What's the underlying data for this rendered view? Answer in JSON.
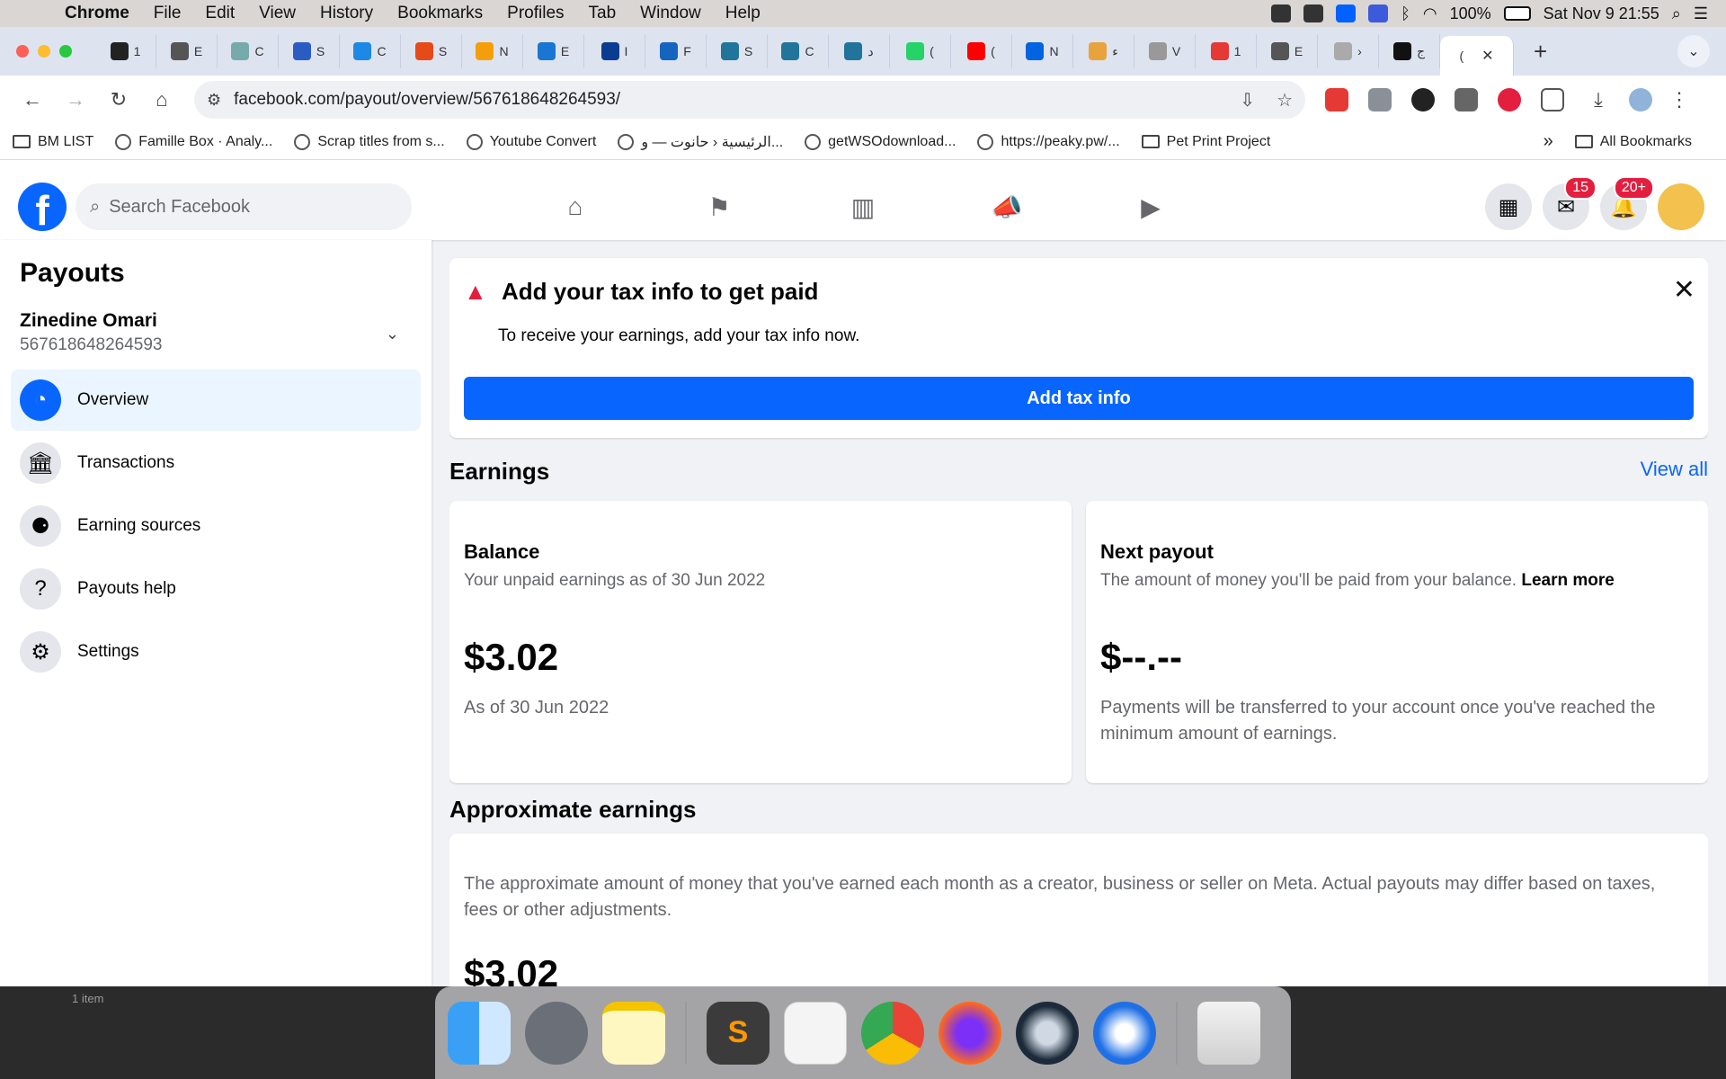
{
  "menubar": {
    "items": [
      "Chrome",
      "File",
      "Edit",
      "View",
      "History",
      "Bookmarks",
      "Profiles",
      "Tab",
      "Window",
      "Help"
    ],
    "battery": "100%",
    "datetime": "Sat Nov 9  21:55"
  },
  "tabs": [
    {
      "letter": "1",
      "color": "#222"
    },
    {
      "letter": "E",
      "color": "#555"
    },
    {
      "letter": "C",
      "color": "#7aa"
    },
    {
      "letter": "S",
      "color": "#2b5cc4"
    },
    {
      "letter": "C",
      "color": "#1e88e5"
    },
    {
      "letter": "S",
      "color": "#e64a19"
    },
    {
      "letter": "N",
      "color": "#f59e0b"
    },
    {
      "letter": "E",
      "color": "#1976d2"
    },
    {
      "letter": "I",
      "color": "#0a3d91"
    },
    {
      "letter": "F",
      "color": "#1565c0"
    },
    {
      "letter": "S",
      "color": "#21759b"
    },
    {
      "letter": "C",
      "color": "#21759b"
    },
    {
      "letter": "د",
      "color": "#21759b"
    },
    {
      "letter": "(",
      "color": "#25d366"
    },
    {
      "letter": "(",
      "color": "#ff0000"
    },
    {
      "letter": "N",
      "color": "#0064e0"
    },
    {
      "letter": "ء",
      "color": "#e8a33d"
    },
    {
      "letter": "V",
      "color": "#999"
    },
    {
      "letter": "1",
      "color": "#e53935"
    },
    {
      "letter": "E",
      "color": "#555"
    },
    {
      "letter": "›",
      "color": "#aaa"
    },
    {
      "letter": "ج",
      "color": "#111"
    }
  ],
  "active_tab": {
    "letter": "(",
    "close": "✕"
  },
  "address_bar": {
    "url": "facebook.com/payout/overview/567618648264593/"
  },
  "bookmarks": [
    {
      "label": "BM LIST",
      "type": "folder"
    },
    {
      "label": "Famille Box · Analy...",
      "type": "site"
    },
    {
      "label": "Scrap titles from s...",
      "type": "site"
    },
    {
      "label": "Youtube Convert",
      "type": "site"
    },
    {
      "label": "الرئيسية ‹ حانوت — و...",
      "type": "site"
    },
    {
      "label": "getWSOdownload...",
      "type": "site"
    },
    {
      "label": "https://peaky.pw/...",
      "type": "site"
    },
    {
      "label": "Pet Print Project",
      "type": "folder"
    }
  ],
  "bookmarks_more": "»",
  "all_bookmarks": "All Bookmarks",
  "facebook": {
    "logo": "f",
    "search_placeholder": "Search Facebook",
    "messenger_badge": "15",
    "notifications_badge": "20+"
  },
  "sidebar": {
    "title": "Payouts",
    "account_name": "Zinedine Omari",
    "account_id": "567618648264593",
    "items": [
      {
        "label": "Overview",
        "active": true
      },
      {
        "label": "Transactions",
        "active": false
      },
      {
        "label": "Earning sources",
        "active": false
      },
      {
        "label": "Payouts help",
        "active": false
      },
      {
        "label": "Settings",
        "active": false
      }
    ]
  },
  "tax_banner": {
    "title": "Add your tax info to get paid",
    "body": "To receive your earnings, add your tax info now.",
    "button": "Add tax info"
  },
  "earnings": {
    "title": "Earnings",
    "view_all": "View all",
    "balance": {
      "title": "Balance",
      "subtitle": "Your unpaid earnings as of 30 Jun 2022",
      "amount": "$3.02",
      "note": "As of 30 Jun 2022"
    },
    "next_payout": {
      "title": "Next payout",
      "subtitle": "The amount of money you'll be paid from your balance.",
      "learn_more": "Learn more",
      "amount": "$--.--",
      "note": "Payments will be transferred to your account once you've reached the minimum amount of earnings."
    }
  },
  "approximate": {
    "title": "Approximate earnings",
    "description": "The approximate amount of money that you've earned each month as a creator, business or seller on Meta. Actual payouts may differ based on taxes, fees or other adjustments.",
    "amount": "$3.02"
  },
  "desktop": {
    "label": "1 item"
  },
  "colors": {
    "fb_blue": "#0866ff",
    "badge_red": "#e41e3f",
    "page_bg": "#f0f2f5"
  }
}
